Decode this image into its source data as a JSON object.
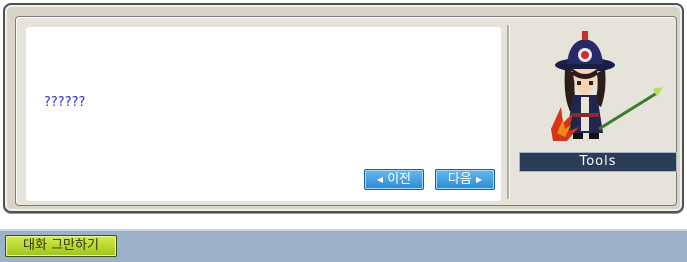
{
  "dialog": {
    "message": "??????",
    "prev_button": "이전",
    "next_button": "다음",
    "npc_name": "Tools"
  },
  "bottom_bar": {
    "end_chat_button": "대화 그만하기"
  },
  "icons": {
    "prev": "left-triangle-icon",
    "next": "right-triangle-icon"
  },
  "colors": {
    "message_text": "#3333cc",
    "nav_button": "#2b8ad4",
    "end_chat_button": "#b4d42c",
    "nametag": "#2a3c58",
    "bottom_bar": "#9db1c8"
  }
}
